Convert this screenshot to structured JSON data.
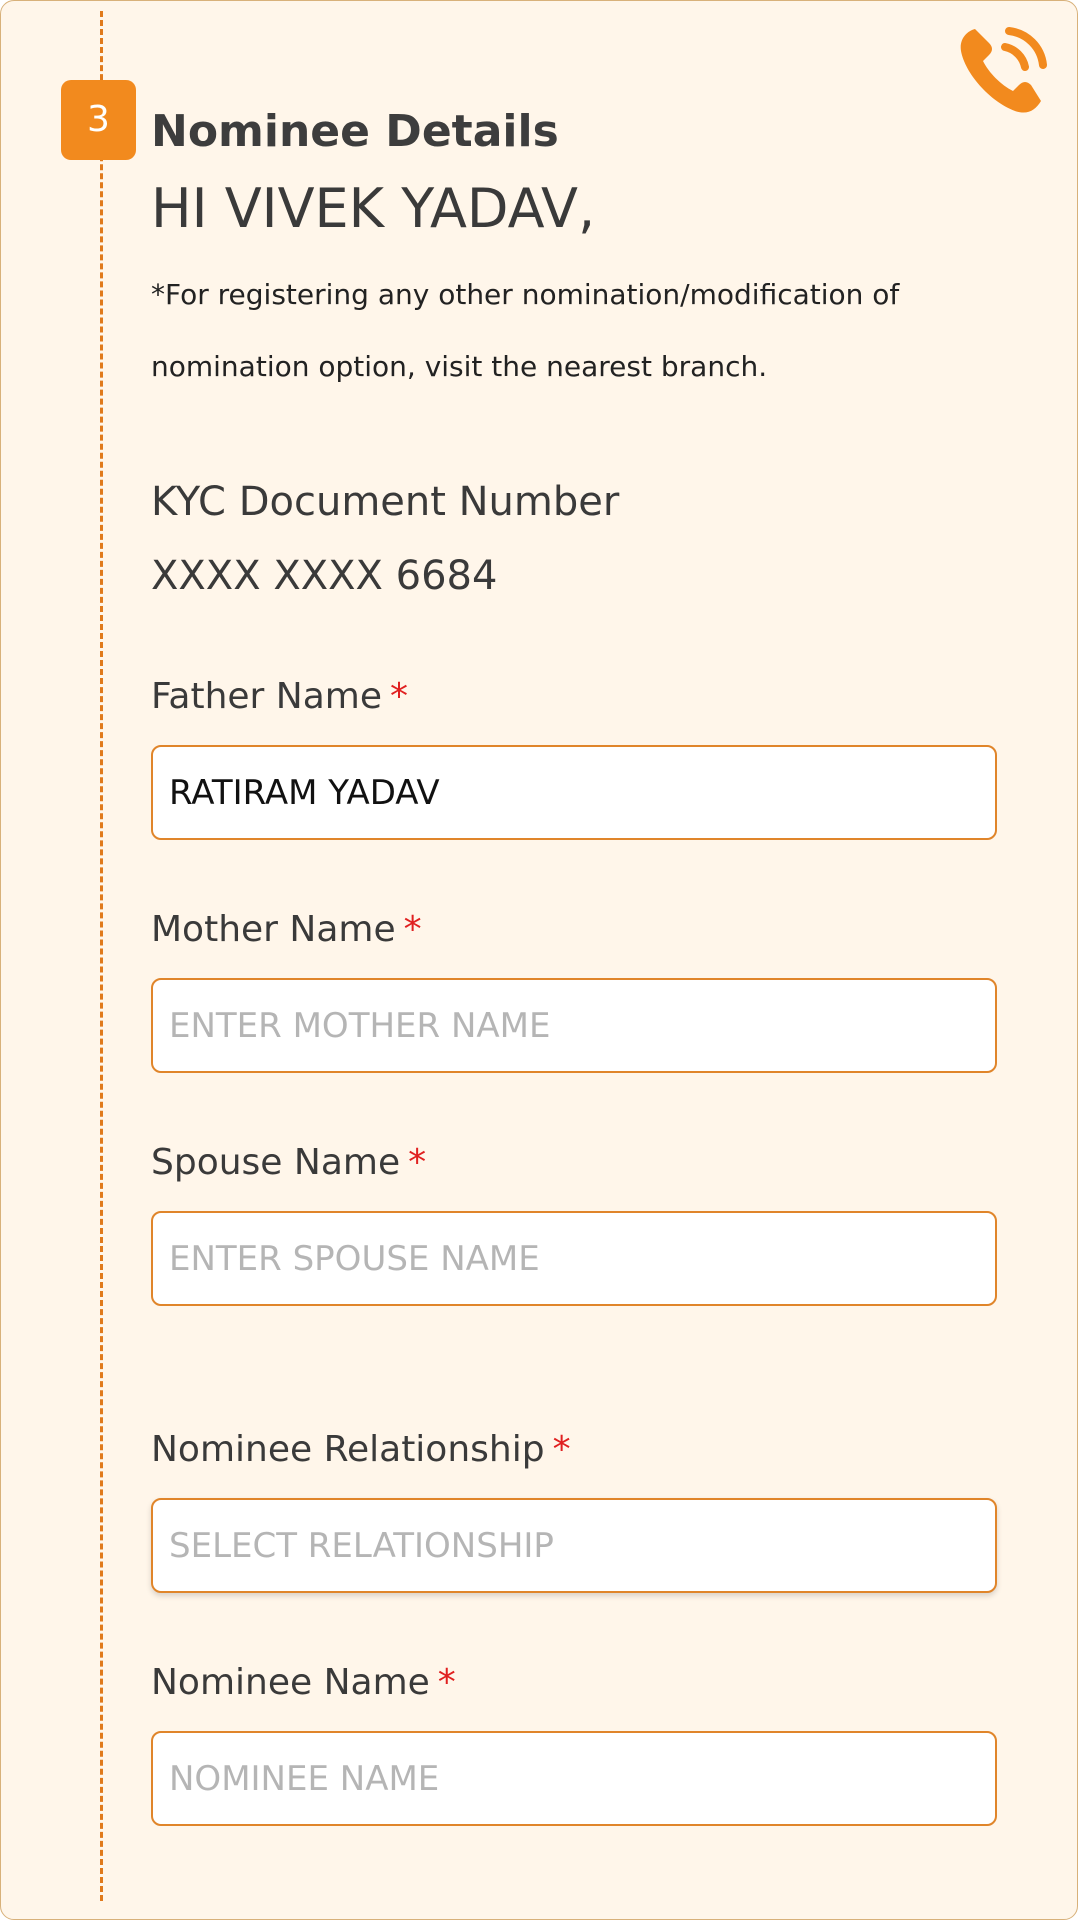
{
  "section": {
    "step_number": "3",
    "title": "Nominee Details"
  },
  "greeting": "HI VIVEK YADAV,",
  "note": "*For registering any other nomination/modification of nomination option, visit the nearest branch.",
  "kyc": {
    "label": "KYC Document Number",
    "value": "XXXX XXXX 6684"
  },
  "fields": {
    "father": {
      "label": "Father Name",
      "required_mark": "*",
      "value": "RATIRAM YADAV",
      "placeholder": ""
    },
    "mother": {
      "label": "Mother Name",
      "required_mark": "*",
      "value": "",
      "placeholder": "ENTER MOTHER NAME"
    },
    "spouse": {
      "label": "Spouse Name",
      "required_mark": "*",
      "value": "",
      "placeholder": "ENTER SPOUSE NAME"
    },
    "relationship": {
      "label": "Nominee Relationship",
      "required_mark": "*",
      "value": "",
      "placeholder": "SELECT RELATIONSHIP"
    },
    "nominee": {
      "label": "Nominee Name",
      "required_mark": "*",
      "value": "",
      "placeholder": "NOMINEE NAME"
    }
  },
  "icons": {
    "call": "phone-call-icon"
  },
  "colors": {
    "accent": "#f28a1e",
    "card_background": "#fff6ea",
    "required": "#e02020",
    "input_border": "#e0852a"
  }
}
